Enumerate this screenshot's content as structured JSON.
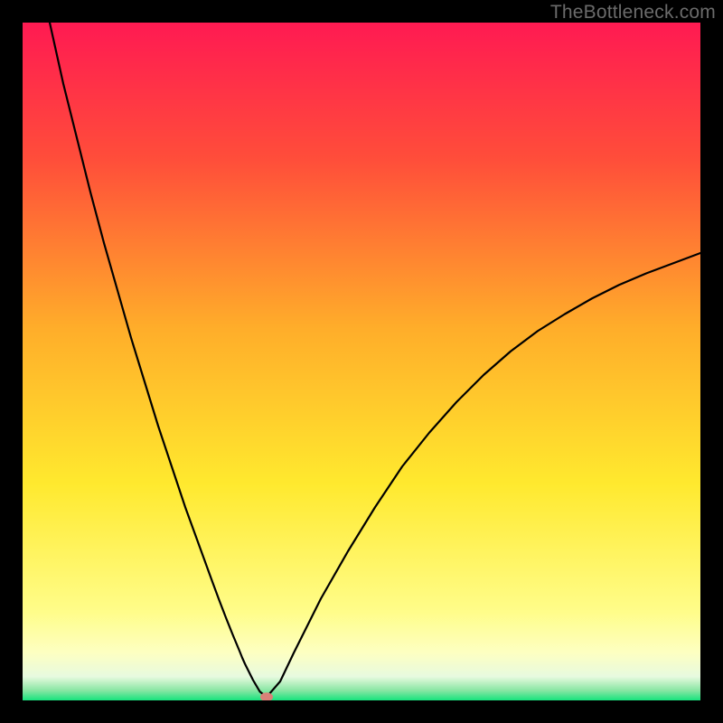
{
  "watermark": "TheBottleneck.com",
  "chart_data": {
    "type": "line",
    "title": "",
    "xlabel": "",
    "ylabel": "",
    "xlim": [
      0,
      100
    ],
    "ylim": [
      0,
      100
    ],
    "x": [
      4.0,
      6.0,
      8.0,
      10.0,
      12.0,
      14.0,
      16.0,
      18.0,
      20.0,
      22.0,
      24.0,
      26.0,
      28.0,
      29.0,
      30.0,
      31.0,
      32.0,
      32.4,
      32.8,
      33.2,
      33.6,
      34.0,
      35.0,
      36.0,
      38.0,
      40.0,
      44.0,
      48.0,
      52.0,
      56.0,
      60.0,
      64.0,
      68.0,
      72.0,
      76.0,
      80.0,
      84.0,
      88.0,
      92.0,
      96.0,
      100.0
    ],
    "values": [
      100.0,
      91.0,
      83.0,
      75.0,
      67.5,
      60.5,
      53.5,
      47.0,
      40.5,
      34.5,
      28.5,
      23.0,
      17.5,
      14.8,
      12.2,
      9.7,
      7.3,
      6.3,
      5.4,
      4.6,
      3.8,
      3.0,
      1.3,
      0.5,
      2.8,
      7.0,
      15.0,
      22.0,
      28.5,
      34.5,
      39.5,
      44.0,
      48.0,
      51.5,
      54.5,
      57.0,
      59.3,
      61.3,
      63.0,
      64.5,
      66.0
    ],
    "min_point": {
      "x": 36.0,
      "y": 0.5
    },
    "gradient_stops": [
      {
        "offset": 0.0,
        "color": "#ff1a52"
      },
      {
        "offset": 0.2,
        "color": "#ff4d3a"
      },
      {
        "offset": 0.45,
        "color": "#ffad2a"
      },
      {
        "offset": 0.68,
        "color": "#ffe92e"
      },
      {
        "offset": 0.87,
        "color": "#fffd8a"
      },
      {
        "offset": 0.93,
        "color": "#fdffc2"
      },
      {
        "offset": 0.965,
        "color": "#e7fadf"
      },
      {
        "offset": 0.985,
        "color": "#8ae6a4"
      },
      {
        "offset": 1.0,
        "color": "#17e37d"
      }
    ]
  }
}
